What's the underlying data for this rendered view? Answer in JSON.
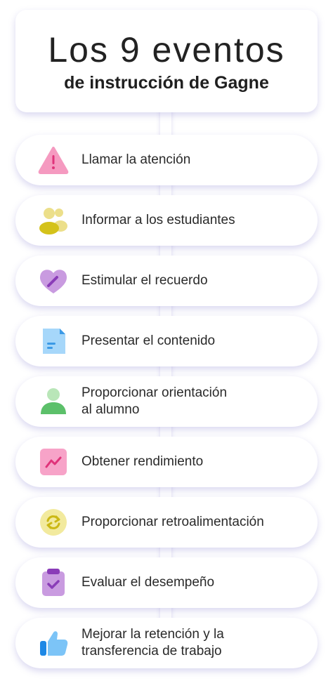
{
  "title": {
    "main": "Los 9 eventos",
    "sub": "de instrucción de Gagne"
  },
  "items": [
    {
      "label": "Llamar la atención",
      "icon": "warning-triangle-icon"
    },
    {
      "label": "Informar a los estudiantes",
      "icon": "students-group-icon"
    },
    {
      "label": "Estimular el recuerdo",
      "icon": "heart-pen-icon"
    },
    {
      "label": "Presentar el contenido",
      "icon": "document-icon"
    },
    {
      "label_line1": "Proporcionar orientación",
      "label_line2": "al alumno",
      "icon": "person-icon"
    },
    {
      "label": "Obtener rendimiento",
      "icon": "trend-chart-icon"
    },
    {
      "label": "Proporcionar retroalimentación",
      "icon": "refresh-cycle-icon"
    },
    {
      "label": "Evaluar el desempeño",
      "icon": "clipboard-check-icon"
    },
    {
      "label_line1": "Mejorar la retención y la",
      "label_line2": "transferencia de trabajo",
      "icon": "thumbs-up-icon"
    }
  ],
  "colors": {
    "shadow": "#b8b0e8",
    "pink": "#f472b6",
    "yellow": "#d4c21a",
    "purple": "#b57ad6",
    "blue": "#5bb8f5",
    "green": "#5cc06a"
  }
}
